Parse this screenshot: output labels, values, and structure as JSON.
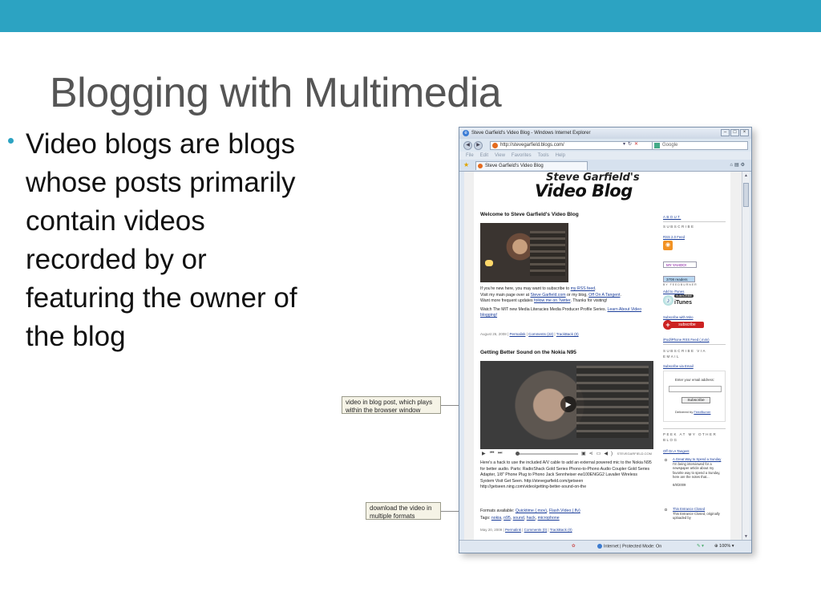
{
  "slide": {
    "title": "Blogging with Multimedia",
    "bullet": "Video blogs are blogs whose posts primarily contain videos recorded by or featuring the owner of the blog",
    "accent_color": "#2ca3c2"
  },
  "callouts": [
    {
      "text": "video in blog post, which plays within the browser window"
    },
    {
      "text": "download the video in multiple formats"
    }
  ],
  "browser": {
    "window_title": "Steve Garfield's Video Blog - Windows Internet Explorer",
    "address": "http://stevegarfield.blogs.com/",
    "search_placeholder": "Google",
    "menu": [
      "File",
      "Edit",
      "View",
      "Favorites",
      "Tools",
      "Help"
    ],
    "tab_title": "Steve Garfield's Video Blog",
    "status_zone": "Internet | Protected Mode: On",
    "zoom": "100%"
  },
  "blog": {
    "logo_line1": "Steve Garfield's",
    "logo_line2": "Video Blog",
    "post1": {
      "title": "Welcome to Steve Garfield's Video Blog",
      "line1_pre": "If you're new here, you may want to subscribe to ",
      "line1_link": "my RSS feed",
      "line1_post": ".",
      "line2_pre": "Visit my main page over at ",
      "line2_link1": "Steve Garfield.com",
      "line2_mid": " or my blog, ",
      "line2_link2": "Off On A Tangent",
      "line2_post": ".",
      "line3_pre": "Want more frequent updates ",
      "line3_link": "follow me on Twitter",
      "line3_post": ". Thanks for visiting!",
      "line4_pre": "Watch The MIT new Media Literacies Media Producer Profile Series. ",
      "line4_link": "Learn About Video blogging!",
      "meta_date": "August 26, 2008",
      "meta_permalink": "Permalink",
      "meta_comments": "Comments (22)",
      "meta_trackback": "TrackBack (0)"
    },
    "post2": {
      "title": "Getting Better Sound on the Nokia N95",
      "player_brand": "STEVEGARFIELD.COM",
      "body": "Here's a hack to use the included A/V cable to add an external powered mic to the Nokia N95 for better audio. Parts: RadioShack Gold Series Phono-to-Phono Audio Coupler Gold Series Adapter, 1/8\" Phone Plug to Phono Jack Sennheiser ew100ENGG2 Lavalier Wireless System Visit Get Seen. http://stevegarfield.com/getseen http://getseen.ning.com/video/getting-better-sound-on-the",
      "formats_label": "Formats available: ",
      "format1": "Quicktime (.mov)",
      "format2": "Flash Video (.flv)",
      "tags_label": "Tags: ",
      "tags": [
        "nokia",
        "n95",
        "sound",
        "hack",
        "microphone"
      ],
      "meta_date": "May 20, 2009",
      "meta_permalink": "Permalink",
      "meta_comments": "Comments (0)",
      "meta_trackback": "TrackBack (0)"
    },
    "sidebar": {
      "about": "ABOUT",
      "subscribe": "SUBSCRIBE",
      "rss_link": "RSS 2.0 Feed",
      "my_yahoo": "MY YAHOO!",
      "readers": "3708 readers",
      "feedburner": "BY FEEDBURNER",
      "add_itunes": "Add to iTunes",
      "itunes_label": "iTunes",
      "itunes_sub": "SUBSCRIBE",
      "subscribe_miro": "Subscribe with Miro",
      "subscribe_btn": "subscribe",
      "ipod_link": "iPod/iPhone RSS Feed (.m4v)",
      "via_email_heading": "SUBSCRIBE VIA EMAIL",
      "via_email_link": "Subscribe via Email",
      "email_label": "Enter your email address:",
      "email_button": "Subscribe",
      "delivered_by": "Delivered by ",
      "delivered_link": "FeedBurner",
      "peek_heading": "PEEK AT MY OTHER BLOG",
      "other_blog": "Off On A Tangent",
      "item1_link": "A Great Way to Spend a Sunday",
      "item1_text": "I'm being interviewed for a newspaper article about my favorite way to spend a Sunday, here are the notes that...",
      "item1_date": "6/8/2009",
      "item2_link": "This Entrance Closed",
      "item2_text": "This Entrance Closed, originally uploaded by"
    }
  }
}
